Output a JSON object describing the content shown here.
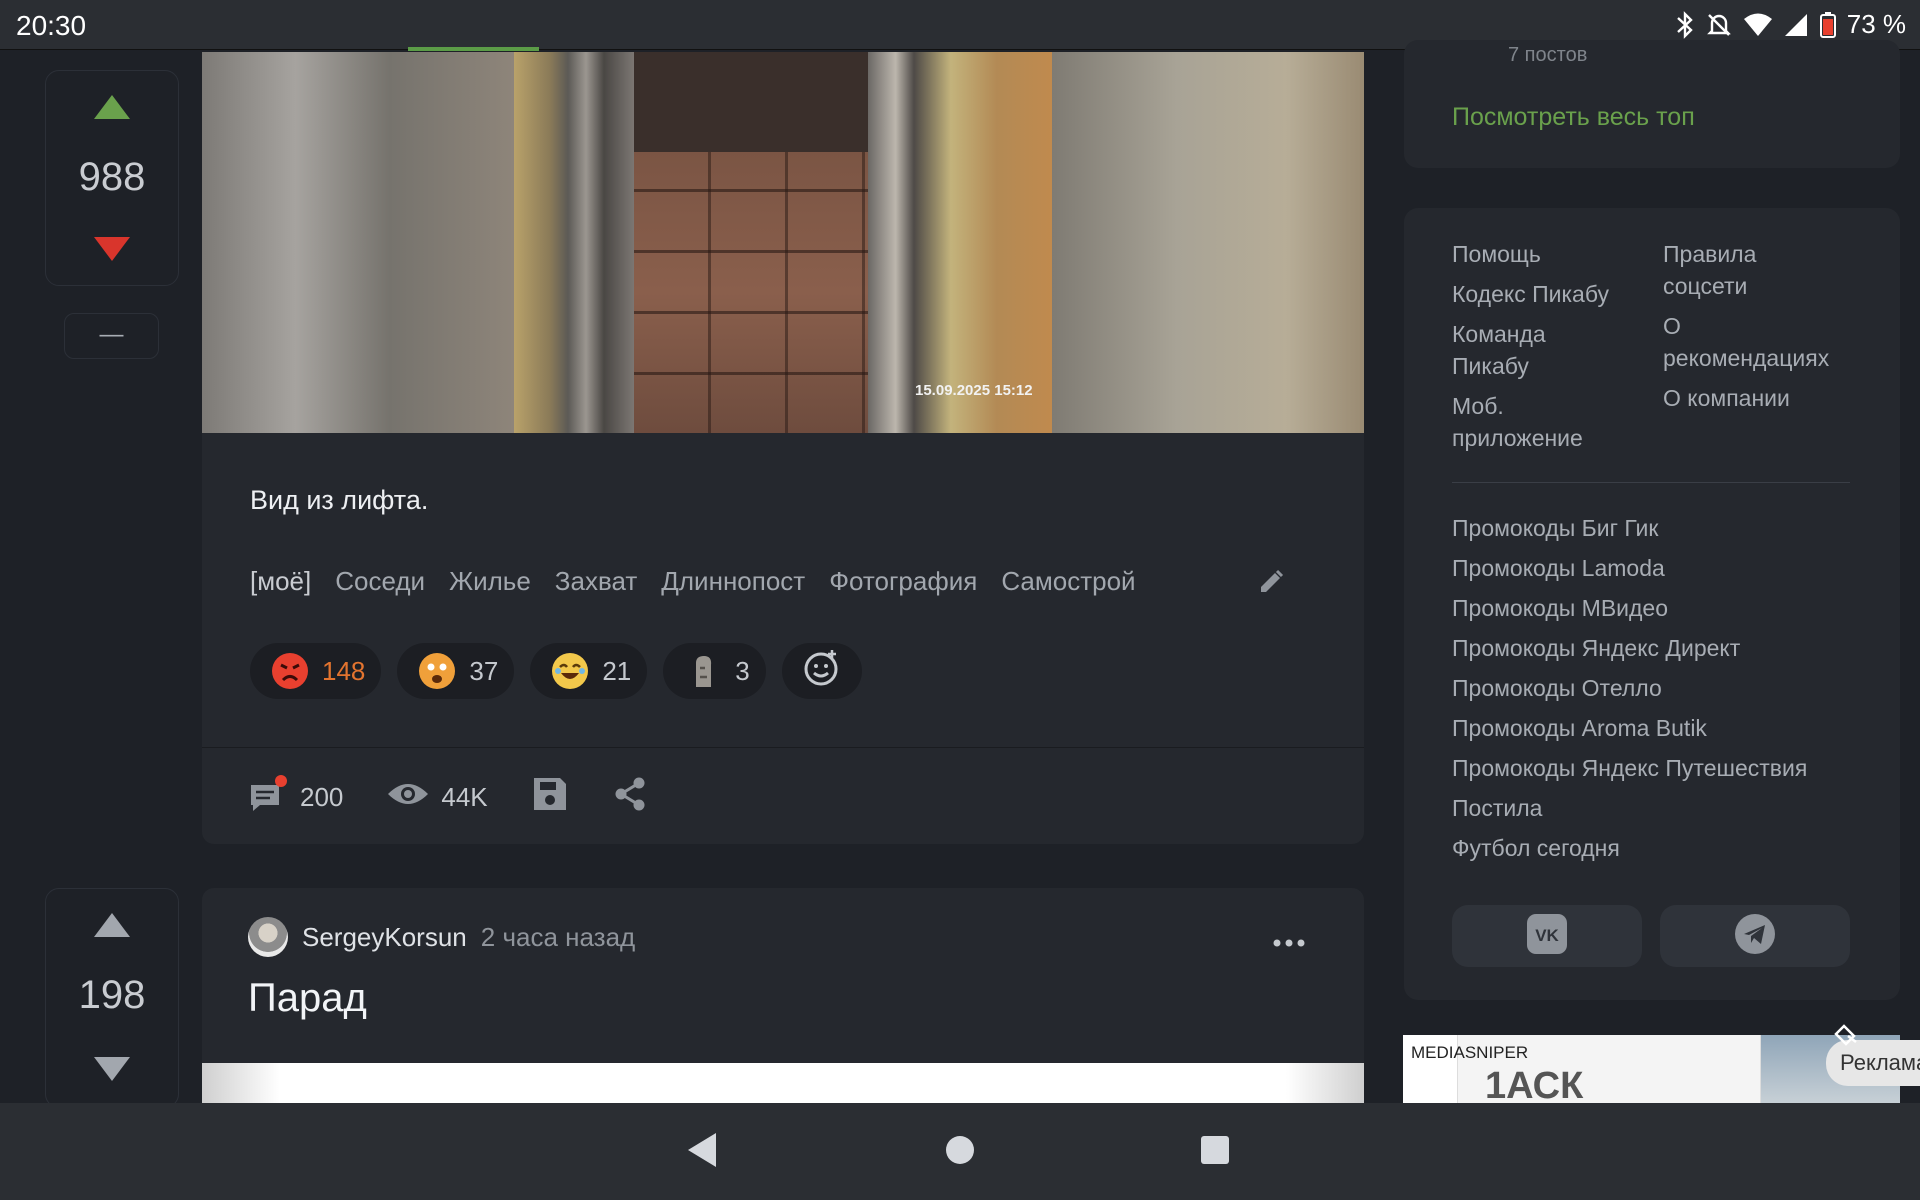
{
  "status_bar": {
    "time": "20:30",
    "battery": "73 %",
    "icons": [
      "bluetooth-icon",
      "bell-off-icon",
      "wifi-icon",
      "signal-icon",
      "battery-icon"
    ]
  },
  "post1": {
    "rating": "988",
    "minus_label": "—",
    "photo_timestamp": "15.09.2025 15:12",
    "text": "Вид из лифта.",
    "tags": [
      "[моё]",
      "Соседи",
      "Жилье",
      "Захват",
      "Длиннопост",
      "Фотография",
      "Самострой"
    ],
    "reactions": [
      {
        "icon": "angry-face-icon",
        "count": "148",
        "color": "#e8402f"
      },
      {
        "icon": "shocked-face-icon",
        "count": "37",
        "color": "#f0a03a"
      },
      {
        "icon": "laughing-face-icon",
        "count": "21",
        "color": "#f2c84b"
      },
      {
        "icon": "moai-icon",
        "count": "3",
        "color": "#9a9690"
      }
    ],
    "comments": "200",
    "views": "44K"
  },
  "post2": {
    "rating": "198",
    "author": "SergeyKorsun",
    "time": "2 часа назад",
    "title": "Парад"
  },
  "sidebar": {
    "top_posts_count": "7 постов",
    "see_all_top": "Посмотреть весь топ",
    "links_left": [
      "Помощь",
      "Кодекс Пикабу",
      "Команда Пикабу",
      "Моб. приложение"
    ],
    "links_right": [
      "Правила соцсети",
      "О рекомендациях",
      "О компании"
    ],
    "promo_links": [
      "Промокоды Биг Гик",
      "Промокоды Lamoda",
      "Промокоды МВидео",
      "Промокоды Яндекс Директ",
      "Промокоды Отелло",
      "Промокоды Aroma Butik",
      "Промокоды Яндекс Путешествия",
      "Постила",
      "Футбол сегодня"
    ],
    "ad_label": "MEDIASNIPER",
    "ad_logo": "1АСК",
    "ad_badge": "Реклама"
  }
}
